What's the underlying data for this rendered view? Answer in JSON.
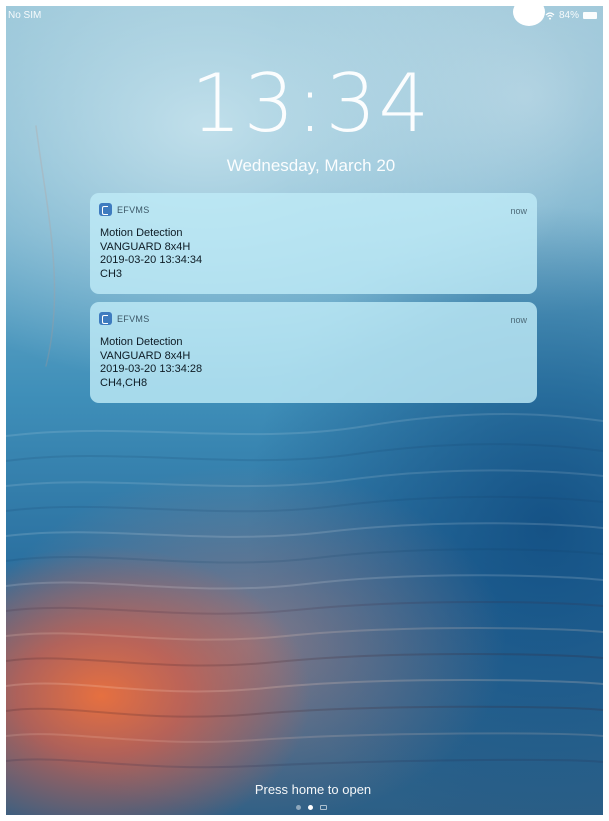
{
  "status_bar": {
    "carrier": "No SIM",
    "wifi_icon": "wifi-icon",
    "battery_percent": "84%",
    "battery_icon": "battery-icon"
  },
  "lock_screen": {
    "time": "13:34",
    "date": "Wednesday, March 20"
  },
  "notifications": [
    {
      "app_name": "EFVMS",
      "time": "now",
      "lines": [
        "Motion Detection",
        "VANGUARD 8x4H",
        "2019-03-20 13:34:34",
        "CH3"
      ]
    },
    {
      "app_name": "EFVMS",
      "time": "now",
      "lines": [
        "Motion Detection",
        "VANGUARD 8x4H",
        "2019-03-20 13:34:28",
        "CH4,CH8"
      ]
    }
  ],
  "bottom": {
    "hint": "Press home to open",
    "page_indicator": "page 2 of 3 with camera",
    "camera_icon": "camera-icon"
  }
}
